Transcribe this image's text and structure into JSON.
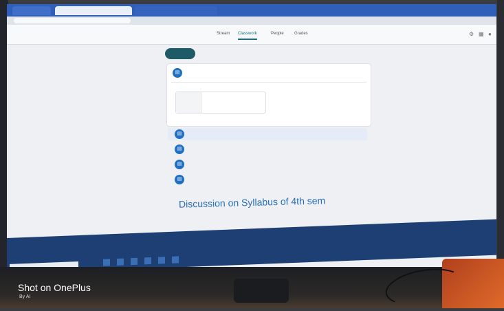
{
  "photo": {
    "watermark": "Shot on OnePlus",
    "watermark_sub": "By AI"
  },
  "browser": {
    "tabs": [
      "",
      "",
      ""
    ]
  },
  "classroom": {
    "class_title": "",
    "nav_tabs": [
      "Stream",
      "Classwork",
      "People",
      "Grades"
    ],
    "active_tab": 1,
    "left_panel": {
      "title": "",
      "subtitle": ""
    },
    "create_label": "",
    "calendar_link": "",
    "drive_link": "",
    "post": {
      "author_icon": "assignment-icon",
      "title": "",
      "date": "",
      "attachment_name": "",
      "attachment_type": ""
    },
    "section_label": "",
    "items": [
      {
        "text": "",
        "date": "",
        "highlight": true
      },
      {
        "text": "",
        "date": "",
        "highlight": false
      },
      {
        "text": "",
        "date": "",
        "highlight": false
      },
      {
        "text": "",
        "date": "",
        "highlight": false
      }
    ],
    "discussion_heading": "Discussion on Syllabus of 4th sem",
    "discussion_sub": ""
  },
  "taskbar": {
    "search_placeholder": "",
    "tray_text": ""
  }
}
